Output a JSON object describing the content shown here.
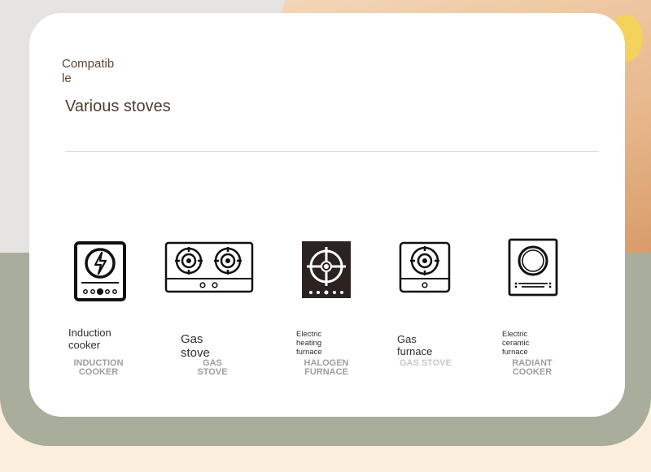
{
  "header": {
    "compatible": "Compatib\nle",
    "title": "Various stoves"
  },
  "stoves": [
    {
      "name": "Induction\ncooker",
      "en": "INDUCTION\nCOOKER",
      "icon": "induction-cooker-icon"
    },
    {
      "name": "Gas stove",
      "en": "GAS\nSTOVE",
      "icon": "double-gas-stove-icon"
    },
    {
      "name": "Electric heating\nfurnace",
      "en": "HALOGEN\nFURNACE",
      "icon": "halogen-furnace-icon"
    },
    {
      "name": "Gas furnace",
      "en": "GAS STOVE",
      "icon": "single-gas-stove-icon"
    },
    {
      "name": "Electric ceramic\nfurnace",
      "en": "RADIANT\nCOOKER",
      "icon": "radiant-cooker-icon"
    }
  ],
  "colors": {
    "card": "#ffffff",
    "green_band": "#a9ad9b",
    "title": "#4e3d2d"
  }
}
